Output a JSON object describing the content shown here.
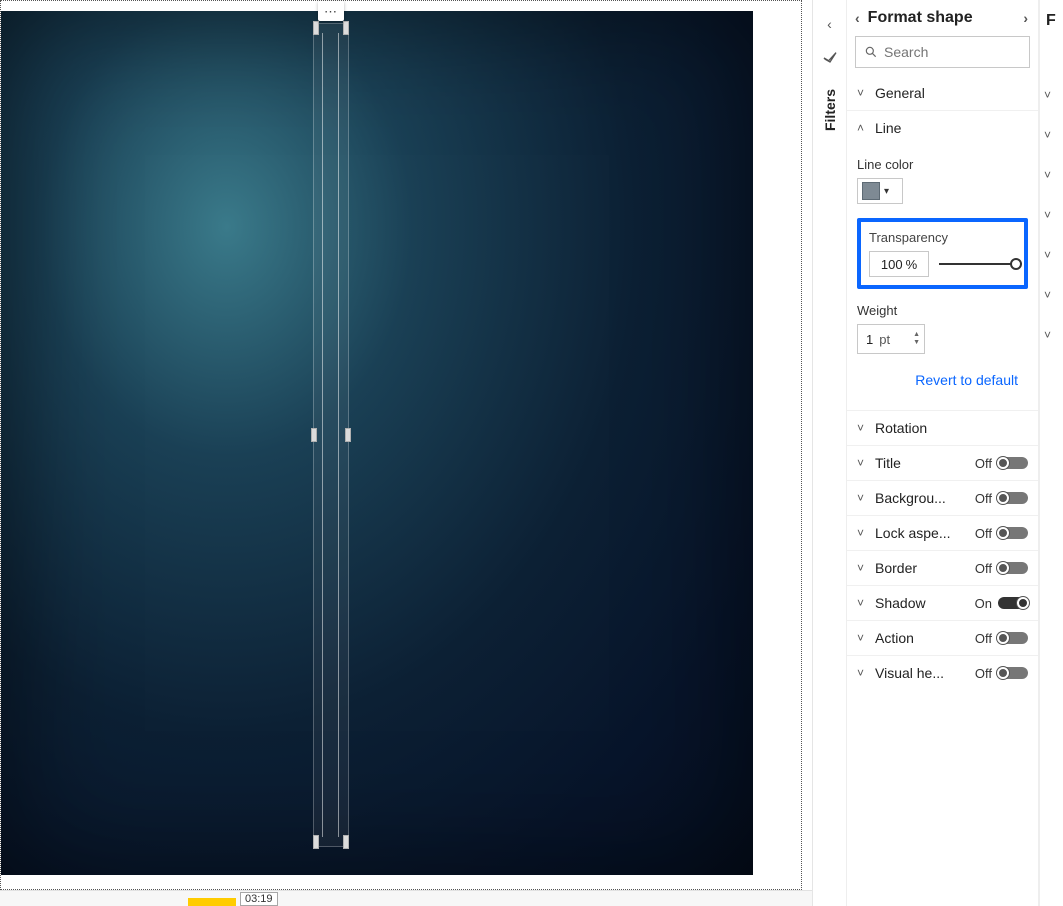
{
  "canvas": {
    "more_glyph": "⋯",
    "timeline_time": "03:19"
  },
  "filters_tab": {
    "label": "Filters"
  },
  "format_panel": {
    "title": "Format shape",
    "search_placeholder": "Search",
    "sections": {
      "general": {
        "label": "General",
        "expanded": false
      },
      "line": {
        "label": "Line",
        "expanded": true
      },
      "rotation": {
        "label": "Rotation",
        "expanded": false,
        "toggle": null
      },
      "title": {
        "label": "Title",
        "toggle_state": "Off"
      },
      "background": {
        "label": "Backgrou...",
        "toggle_state": "Off"
      },
      "lock": {
        "label": "Lock aspe...",
        "toggle_state": "Off"
      },
      "border": {
        "label": "Border",
        "toggle_state": "Off"
      },
      "shadow": {
        "label": "Shadow",
        "toggle_state": "On"
      },
      "action": {
        "label": "Action",
        "toggle_state": "Off"
      },
      "visualheader": {
        "label": "Visual he...",
        "toggle_state": "Off"
      }
    },
    "line": {
      "color_label": "Line color",
      "color_hex": "#7e8a94",
      "transparency_label": "Transparency",
      "transparency_value": "100",
      "transparency_unit": "%",
      "weight_label": "Weight",
      "weight_value": "1",
      "weight_unit": "pt"
    },
    "revert_label": "Revert to default"
  },
  "right_sliver": {
    "partial_letter": "F"
  }
}
